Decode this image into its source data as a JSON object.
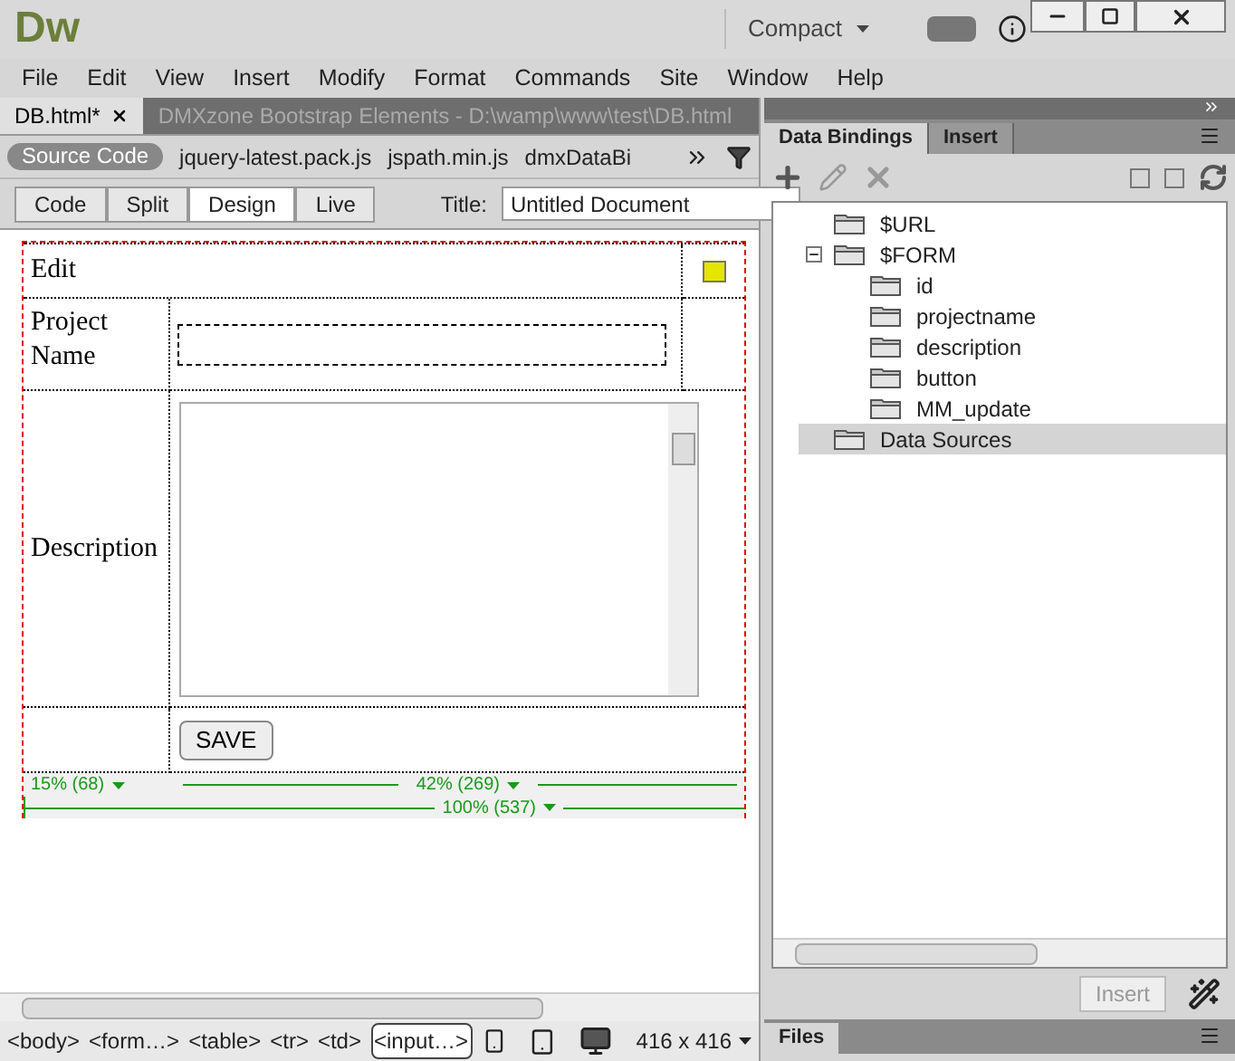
{
  "app": {
    "logo": "Dw",
    "workspace": "Compact"
  },
  "menu": [
    "File",
    "Edit",
    "View",
    "Insert",
    "Modify",
    "Format",
    "Commands",
    "Site",
    "Window",
    "Help"
  ],
  "doc_tabs": [
    {
      "label": "DB.html*",
      "selected": true
    },
    {
      "label": "DMXzone Bootstrap Elements - D:\\wamp\\www\\test\\DB.html",
      "selected": false
    }
  ],
  "related_files": {
    "source": "Source Code",
    "files": [
      "jquery-latest.pack.js",
      "jspath.min.js",
      "dmxDataBi"
    ]
  },
  "view_buttons": [
    {
      "label": "Code",
      "selected": false
    },
    {
      "label": "Split",
      "selected": false
    },
    {
      "label": "Design",
      "selected": true
    },
    {
      "label": "Live",
      "selected": false
    }
  ],
  "title_field": {
    "label": "Title:",
    "value": "Untitled Document"
  },
  "form": {
    "heading": "Edit",
    "name_label": "Project Name",
    "description_label": "Description",
    "save_button": "SAVE"
  },
  "width_rulers": [
    "15% (68)",
    "42% (269)",
    "100% (537)"
  ],
  "status_bar": {
    "tags": [
      {
        "label": "<body>",
        "selected": false
      },
      {
        "label": "<form…>",
        "selected": false
      },
      {
        "label": "<table>",
        "selected": false
      },
      {
        "label": "<tr>",
        "selected": false
      },
      {
        "label": "<td>",
        "selected": false
      },
      {
        "label": "<input…>",
        "selected": true
      }
    ],
    "size": "416 x 416"
  },
  "panel": {
    "tabs": [
      {
        "label": "Data Bindings",
        "selected": true
      },
      {
        "label": "Insert",
        "selected": false
      }
    ],
    "tree": [
      {
        "label": "$URL",
        "selected": false
      },
      {
        "label": "$FORM",
        "selected": false,
        "expanded": true,
        "children": [
          {
            "label": "id",
            "selected": false
          },
          {
            "label": "projectname",
            "selected": false
          },
          {
            "label": "description",
            "selected": false
          },
          {
            "label": "button",
            "selected": false
          },
          {
            "label": "MM_update",
            "selected": false
          }
        ]
      },
      {
        "label": "Data Sources",
        "selected": true
      }
    ],
    "insert_button": {
      "label": "Insert",
      "disabled": true
    },
    "files_tab": "Files"
  }
}
